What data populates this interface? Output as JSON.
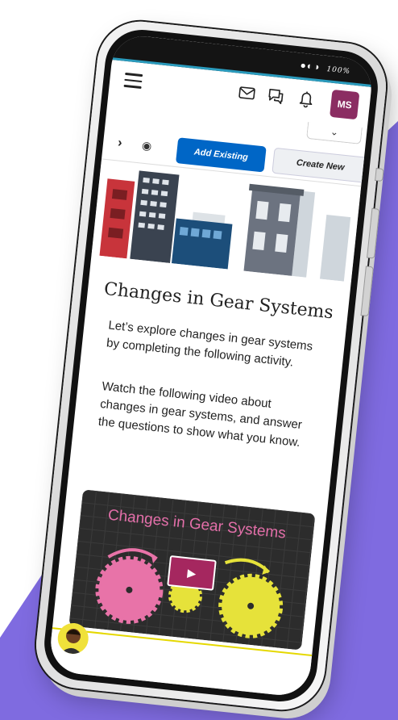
{
  "status_bar": {
    "battery_percent": "100%"
  },
  "header": {
    "menu_icon": "hamburger-menu-icon",
    "mail_icon": "mail-icon",
    "chat_icon": "chat-icon",
    "bell_icon": "bell-icon",
    "user_initials": "MS",
    "dropdown_icon": "chevron-down-icon"
  },
  "toolbar": {
    "next_icon": "chevron-right-icon",
    "preview_icon": "eye-icon",
    "add_existing_label": "Add Existing",
    "create_new_label": "Create New"
  },
  "lesson": {
    "title": "Changes in Gear Systems",
    "paragraph_1": "Let’s explore changes in gear systems by completing the following activity.",
    "paragraph_2": "Watch the following video about changes in gear systems, and answer the questions to show what you know."
  },
  "video": {
    "title": "Changes in Gear Systems",
    "play_icon": "play-icon"
  },
  "colors": {
    "accent_blue": "#0066c6",
    "avatar_magenta": "#8b2d62",
    "background_purple": "#7f6be0",
    "gear_pink": "#e873a8",
    "gear_yellow": "#e6e23a"
  }
}
